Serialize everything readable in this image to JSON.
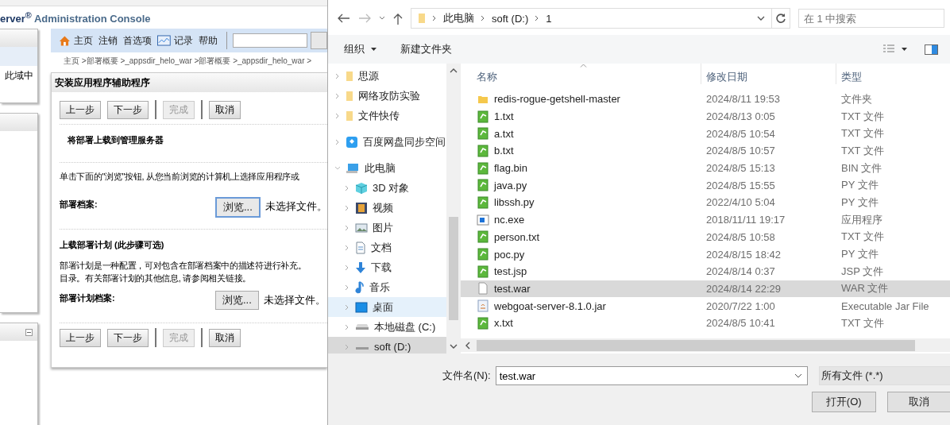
{
  "console": {
    "brand": "erver$^{®}$",
    "title": "Administration Console",
    "side_text": "此域中",
    "toolbar": [
      {
        "label": "主页",
        "kind": "home"
      },
      {
        "label": "注销",
        "kind": "text"
      },
      {
        "label": "首选项",
        "kind": "text"
      },
      {
        "label": "记录",
        "kind": "chart"
      },
      {
        "label": "帮助",
        "kind": "text"
      }
    ],
    "breadcrumb": "主页 >部署概要 >_appsdir_helo_war >部署概要 >_appsdir_helo_war >",
    "panel_title": "安装应用程序辅助程序",
    "wizard_top": [
      {
        "label": "上一步",
        "disabled": false
      },
      {
        "label": "下一步",
        "disabled": false
      },
      {
        "label": "完成",
        "disabled": true
      },
      {
        "label": "取消",
        "disabled": false
      }
    ],
    "section_title": "将部署上载到管理服务器",
    "intro": "单击下面的\"浏览\"按钮, 从您当前浏览的计算机上选择应用程序或",
    "archive": {
      "label": "部署档案:",
      "button": "浏览...",
      "status": "未选择文件。",
      "focused": true
    },
    "plan_title": "上载部署计划 (此步骤可选)",
    "plan_text": [
      "部署计划是一种配置，可对包含在部署档案中的描述符进行补充。",
      "目录。有关部署计划的其他信息, 请参阅相关链接。"
    ],
    "plan_file": {
      "label": "部署计划档案:",
      "button": "浏览...",
      "status": "未选择文件。",
      "focused": false
    },
    "wizard_bottom": [
      {
        "label": "上一步",
        "disabled": false
      },
      {
        "label": "下一步",
        "disabled": false
      },
      {
        "label": "完成",
        "disabled": true
      },
      {
        "label": "取消",
        "disabled": false
      }
    ]
  },
  "dialog": {
    "path": [
      "此电脑",
      "soft (D:)",
      "1"
    ],
    "search": {
      "placeholder": "在 1 中搜索"
    },
    "toolbar": {
      "organize": "组织",
      "new_folder": "新建文件夹"
    },
    "nav": [
      {
        "label": "思源",
        "kind": "folder",
        "selected": false
      },
      {
        "label": "网络攻防实验",
        "kind": "folder",
        "selected": false
      },
      {
        "label": "文件快传",
        "kind": "folder",
        "selected": false
      },
      {
        "label": "百度网盘同步空间",
        "kind": "cloud",
        "selected": false
      },
      {
        "label": "此电脑",
        "kind": "pc",
        "selected": false,
        "expanded": true,
        "children": [
          {
            "label": "3D 对象",
            "kind": "cube",
            "selected": false
          },
          {
            "label": "视频",
            "kind": "video",
            "selected": false
          },
          {
            "label": "图片",
            "kind": "image",
            "selected": false
          },
          {
            "label": "文档",
            "kind": "doc",
            "selected": false
          },
          {
            "label": "下载",
            "kind": "download",
            "selected": false
          },
          {
            "label": "音乐",
            "kind": "music",
            "selected": false
          },
          {
            "label": "桌面",
            "kind": "desktop",
            "selected": true
          },
          {
            "label": "本地磁盘 (C:)",
            "kind": "drive",
            "selected": false
          },
          {
            "label": "soft (D:)",
            "kind": "drive",
            "selected": false,
            "hovered": true
          }
        ]
      }
    ],
    "columns": [
      "名称",
      "修改日期",
      "类型"
    ],
    "files": [
      {
        "name": "redis-rogue-getshell-master",
        "date": "2024/8/11 19:53",
        "type": "文件夹",
        "kind": "folder",
        "selected": false
      },
      {
        "name": "1.txt",
        "date": "2024/8/13 0:05",
        "type": "TXT 文件",
        "kind": "text",
        "selected": false
      },
      {
        "name": "a.txt",
        "date": "2024/8/5 10:54",
        "type": "TXT 文件",
        "kind": "text",
        "selected": false
      },
      {
        "name": "b.txt",
        "date": "2024/8/5 10:57",
        "type": "TXT 文件",
        "kind": "text",
        "selected": false
      },
      {
        "name": "flag.bin",
        "date": "2024/8/5 15:13",
        "type": "BIN 文件",
        "kind": "text",
        "selected": false
      },
      {
        "name": "java.py",
        "date": "2024/8/5 15:55",
        "type": "PY 文件",
        "kind": "text",
        "selected": false
      },
      {
        "name": "libssh.py",
        "date": "2022/4/10 5:04",
        "type": "PY 文件",
        "kind": "text",
        "selected": false
      },
      {
        "name": "nc.exe",
        "date": "2018/11/11 19:17",
        "type": "应用程序",
        "kind": "exe",
        "selected": false
      },
      {
        "name": "person.txt",
        "date": "2024/8/5 10:58",
        "type": "TXT 文件",
        "kind": "text",
        "selected": false
      },
      {
        "name": "poc.py",
        "date": "2024/8/15 18:42",
        "type": "PY 文件",
        "kind": "text",
        "selected": false
      },
      {
        "name": "test.jsp",
        "date": "2024/8/14 0:37",
        "type": "JSP 文件",
        "kind": "text",
        "selected": false
      },
      {
        "name": "test.war",
        "date": "2024/8/14 22:29",
        "type": "WAR 文件",
        "kind": "blank",
        "selected": true
      },
      {
        "name": "webgoat-server-8.1.0.jar",
        "date": "2020/7/22 1:00",
        "type": "Executable Jar File",
        "kind": "jar",
        "selected": false
      },
      {
        "name": "x.txt",
        "date": "2024/8/5 10:41",
        "type": "TXT 文件",
        "kind": "text",
        "selected": false
      }
    ],
    "filename_label": "文件名(N):",
    "filename": "test.war",
    "filter": "所有文件 (*.*)",
    "open": "打开(O)",
    "cancel": "取消"
  }
}
